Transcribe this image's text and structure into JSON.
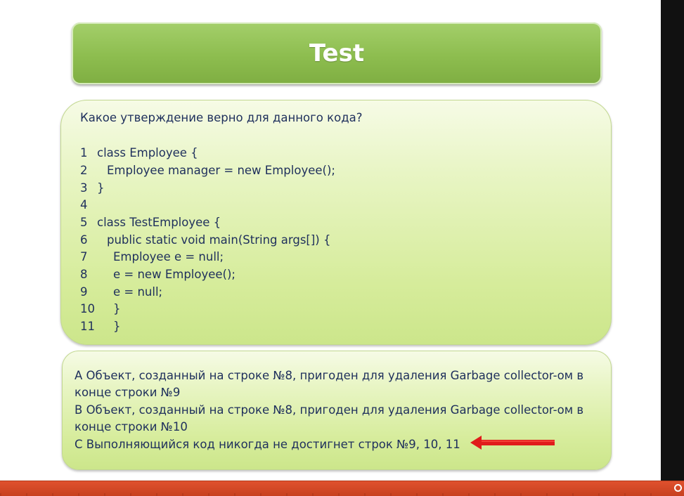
{
  "slide": {
    "title": "Test",
    "question": "Какое утверждение верно для данного кода?",
    "code_lines": [
      {
        "num": "1",
        "text": "class Employee {"
      },
      {
        "num": "2",
        "text": "Employee manager = new Employee();"
      },
      {
        "num": "3",
        "text": "}"
      },
      {
        "num": "4",
        "text": ""
      },
      {
        "num": "5",
        "text": "class TestEmployee {"
      },
      {
        "num": "6",
        "text": "public static void main(String args[]) {"
      },
      {
        "num": "7",
        "text": "Employee e = null;"
      },
      {
        "num": "8",
        "text": "e = new Employee();"
      },
      {
        "num": "9",
        "text": "e = null;"
      },
      {
        "num": "10",
        "text": "}"
      },
      {
        "num": "11",
        "text": "}"
      }
    ],
    "answers": {
      "a_line1": "A  Объект, созданный на строке №8, пригоден для удаления Garbage collector-ом в",
      "a_line2": "конце строки №9",
      "b_line1": "B  Объект, созданный на строке №8, пригоден для удаления Garbage collector-ом в",
      "b_line2": "конце строки №10",
      "c_line1": "C  Выполняющийся код никогда не достигнет строк №9, 10, 11"
    }
  },
  "colors": {
    "title_green": "#8dbd4f",
    "panel_green": "#d6ec9b",
    "text_navy": "#1e2f5c",
    "arrow_red": "#e01b1b",
    "bottom_bar": "#d24a27"
  },
  "icons": {
    "arrow": "red-arrow-left-icon",
    "player": "player-control-icon"
  }
}
